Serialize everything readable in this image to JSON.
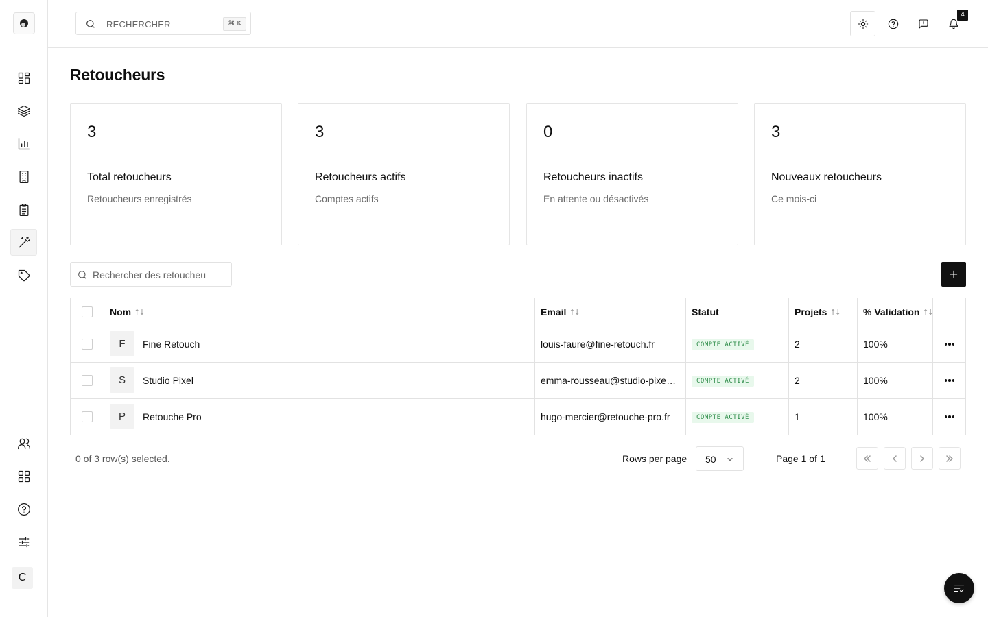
{
  "header": {
    "search_placeholder": "RECHERCHER",
    "search_shortcut": "⌘ K",
    "notification_count": "4"
  },
  "page": {
    "title": "Retoucheurs"
  },
  "cards": [
    {
      "value": "3",
      "title": "Total retoucheurs",
      "subtitle": "Retoucheurs enregistrés"
    },
    {
      "value": "3",
      "title": "Retoucheurs actifs",
      "subtitle": "Comptes actifs"
    },
    {
      "value": "0",
      "title": "Retoucheurs inactifs",
      "subtitle": "En attente ou désactivés"
    },
    {
      "value": "3",
      "title": "Nouveaux retoucheurs",
      "subtitle": "Ce mois-ci"
    }
  ],
  "table_search": {
    "placeholder": "Rechercher des retoucheu"
  },
  "table": {
    "columns": {
      "nom": "Nom",
      "email": "Email",
      "statut": "Statut",
      "projets": "Projets",
      "validation": "% Validation"
    },
    "rows": [
      {
        "initial": "F",
        "name": "Fine Retouch",
        "email": "louis-faure@fine-retouch.fr",
        "status": "COMPTE ACTIVÉ",
        "projects": "2",
        "validation": "100%"
      },
      {
        "initial": "S",
        "name": "Studio Pixel",
        "email": "emma-rousseau@studio-pixe…",
        "status": "COMPTE ACTIVÉ",
        "projects": "2",
        "validation": "100%"
      },
      {
        "initial": "P",
        "name": "Retouche Pro",
        "email": "hugo-mercier@retouche-pro.fr",
        "status": "COMPTE ACTIVÉ",
        "projects": "1",
        "validation": "100%"
      }
    ]
  },
  "pagination": {
    "selection_info": "0 of 3 row(s) selected.",
    "rows_per_page_label": "Rows per page",
    "rows_per_page_value": "50",
    "page_info": "Page 1 of 1"
  },
  "sidebar": {
    "user_initial": "C",
    "icons": [
      "dashboard-icon",
      "layers-icon",
      "bar-chart-icon",
      "building-icon",
      "clipboard-icon",
      "magic-wand-icon",
      "tag-icon",
      "users-icon",
      "apps-grid-icon",
      "help-circle-icon",
      "sliders-icon"
    ]
  },
  "colors": {
    "accent": "#111111",
    "status_active_bg": "#e8f8ec",
    "status_active_text": "#2a8a46"
  }
}
